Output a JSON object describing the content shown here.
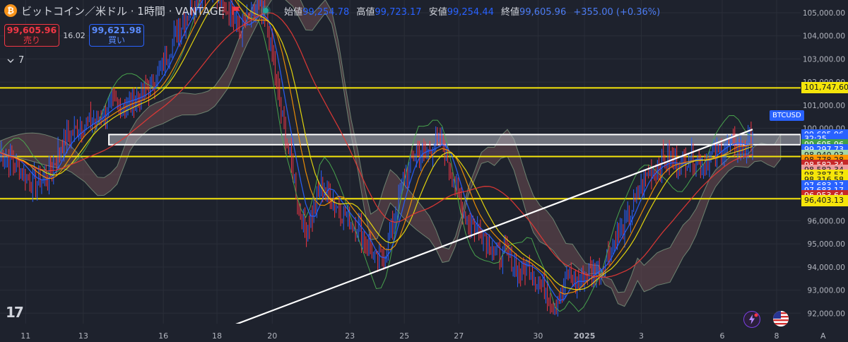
{
  "header": {
    "title": "ビットコイン／米ドル · 1時間 · VANTAGE",
    "coin_glyph": "₿",
    "open_label": "始値",
    "open": "99,254.78",
    "high_label": "高値",
    "high": "99,723.17",
    "low_label": "安値",
    "low": "99,254.44",
    "close_label": "終値",
    "close": "99,605.96",
    "change": "+355.00 (+0.36%)"
  },
  "trade": {
    "sell_price": "99,605.96",
    "sell_label": "売り",
    "spread": "16.02",
    "buy_price": "99,621.98",
    "buy_label": "買い"
  },
  "indicators": {
    "collapse_count": "7"
  },
  "logo": "17",
  "price_tags": [
    {
      "text": "101,747.60",
      "bg": "#f5e50a",
      "fg": "#131722",
      "price": 101747.6
    },
    {
      "text": "99,605.96",
      "bg": "#2962ff",
      "fg": "#ffffff",
      "price": 99700
    },
    {
      "text": "32:25",
      "bg": "#2962ff",
      "fg": "#ffffff",
      "price": 99520
    },
    {
      "text": "99,605.96",
      "bg": "#43a047",
      "fg": "#ffffff",
      "price": 99280
    },
    {
      "text": "99,297.73",
      "bg": "#2962ff",
      "fg": "#ffffff",
      "price": 99060
    },
    {
      "text": "98,940.03",
      "bg": "#a5d6a7",
      "fg": "#131722",
      "price": 98840
    },
    {
      "text": "98,778.28",
      "bg": "#ff9800",
      "fg": "#131722",
      "price": 98620
    },
    {
      "text": "98,582.34",
      "bg": "#c62828",
      "fg": "#ffffff",
      "price": 98400
    },
    {
      "text": "98,582.34",
      "bg": "#ef9a9a",
      "fg": "#131722",
      "price": 98180
    },
    {
      "text": "98,387.57",
      "bg": "#f5e50a",
      "fg": "#131722",
      "price": 97960
    },
    {
      "text": "98,316.58",
      "bg": "#f5e50a",
      "fg": "#131722",
      "price": 97740
    },
    {
      "text": "97,683.17",
      "bg": "#2962ff",
      "fg": "#ffffff",
      "price": 97520
    },
    {
      "text": "97,683.17",
      "bg": "#2962ff",
      "fg": "#ffffff",
      "price": 97300
    },
    {
      "text": "96,953.64",
      "bg": "#c62828",
      "fg": "#ffffff",
      "price": 97080
    },
    {
      "text": "96,403.13",
      "bg": "#f5e50a",
      "fg": "#131722",
      "price": 96860
    }
  ],
  "symbol_tag": "BTCUSD",
  "colors": {
    "background": "#1e222d",
    "grid": "#2a2e39",
    "hline": "#f5e50a",
    "trend": "#ffffff",
    "up": "#2962ff",
    "down": "#f23645",
    "green_line": "#4caf50",
    "red_line": "#e53935",
    "yellow_line": "#f5e50a",
    "blue_line": "#2962ff",
    "cloud": "#6d4c52"
  },
  "chart_data": {
    "type": "candlestick",
    "symbol": "BTCUSD",
    "interval": "1時間",
    "ylim": [
      91550,
      105550
    ],
    "y_ticks": [
      92000,
      93000,
      94000,
      95000,
      96000,
      97000,
      98000,
      99000,
      100000,
      101000,
      102000,
      103000,
      104000,
      105000
    ],
    "y_tick_labels": [
      "92,000.00",
      "93,000.00",
      "94,000.00",
      "95,000.00",
      "96,000.00",
      "97,000.00",
      "98,000.00",
      "99,000.00",
      "100,000.00",
      "101,000.00",
      "102,000.00",
      "103,000.00",
      "104,000.00",
      "105,000.00"
    ],
    "x_ticks": [
      {
        "label": "11",
        "pos": 0.032
      },
      {
        "label": "13",
        "pos": 0.104
      },
      {
        "label": "16",
        "pos": 0.204
      },
      {
        "label": "18",
        "pos": 0.271
      },
      {
        "label": "20",
        "pos": 0.34
      },
      {
        "label": "23",
        "pos": 0.437
      },
      {
        "label": "25",
        "pos": 0.505
      },
      {
        "label": "27",
        "pos": 0.573
      },
      {
        "label": "30",
        "pos": 0.672
      },
      {
        "label": "2025",
        "pos": 0.73,
        "bold": true
      },
      {
        "label": "3",
        "pos": 0.801
      },
      {
        "label": "6",
        "pos": 0.902
      },
      {
        "label": "8",
        "pos": 0.97
      },
      {
        "label": "A",
        "pos": 1.028
      }
    ],
    "horizontal_lines": [
      101747.6,
      98778.28,
      96953.64
    ],
    "zone": {
      "from": 99290,
      "to": 99730,
      "x_start": 0.136,
      "x_end": 1.0
    },
    "trendline": {
      "x1": 0.27,
      "y1": 91200,
      "x2": 0.94,
      "y2": 99950
    },
    "price_path": [
      [
        0.0,
        98950
      ],
      [
        0.02,
        98450
      ],
      [
        0.04,
        97600
      ],
      [
        0.06,
        97900
      ],
      [
        0.08,
        99500
      ],
      [
        0.1,
        100100
      ],
      [
        0.12,
        100400
      ],
      [
        0.14,
        100900
      ],
      [
        0.16,
        101100
      ],
      [
        0.18,
        101500
      ],
      [
        0.2,
        102500
      ],
      [
        0.22,
        104100
      ],
      [
        0.24,
        105300
      ],
      [
        0.26,
        106200
      ],
      [
        0.28,
        105500
      ],
      [
        0.3,
        104200
      ],
      [
        0.31,
        104600
      ],
      [
        0.32,
        105300
      ],
      [
        0.33,
        104800
      ],
      [
        0.34,
        103200
      ],
      [
        0.35,
        100800
      ],
      [
        0.36,
        99200
      ],
      [
        0.37,
        97200
      ],
      [
        0.38,
        95600
      ],
      [
        0.39,
        96200
      ],
      [
        0.4,
        97600
      ],
      [
        0.41,
        97200
      ],
      [
        0.42,
        96700
      ],
      [
        0.43,
        96300
      ],
      [
        0.44,
        95900
      ],
      [
        0.45,
        95600
      ],
      [
        0.46,
        95000
      ],
      [
        0.47,
        94200
      ],
      [
        0.48,
        94600
      ],
      [
        0.49,
        95800
      ],
      [
        0.5,
        97300
      ],
      [
        0.51,
        98200
      ],
      [
        0.52,
        99100
      ],
      [
        0.53,
        98700
      ],
      [
        0.54,
        99200
      ],
      [
        0.55,
        99400
      ],
      [
        0.56,
        98600
      ],
      [
        0.57,
        97300
      ],
      [
        0.58,
        96300
      ],
      [
        0.59,
        95800
      ],
      [
        0.6,
        95600
      ],
      [
        0.61,
        95200
      ],
      [
        0.62,
        94500
      ],
      [
        0.63,
        94600
      ],
      [
        0.64,
        94200
      ],
      [
        0.65,
        93800
      ],
      [
        0.66,
        94100
      ],
      [
        0.67,
        93400
      ],
      [
        0.68,
        93200
      ],
      [
        0.69,
        92300
      ],
      [
        0.7,
        92700
      ],
      [
        0.71,
        93800
      ],
      [
        0.72,
        93300
      ],
      [
        0.73,
        93600
      ],
      [
        0.74,
        93900
      ],
      [
        0.75,
        93900
      ],
      [
        0.76,
        94600
      ],
      [
        0.77,
        95300
      ],
      [
        0.78,
        95700
      ],
      [
        0.79,
        96600
      ],
      [
        0.8,
        97500
      ],
      [
        0.81,
        98100
      ],
      [
        0.82,
        98400
      ],
      [
        0.83,
        98700
      ],
      [
        0.84,
        98600
      ],
      [
        0.85,
        98500
      ],
      [
        0.86,
        98800
      ],
      [
        0.87,
        98700
      ],
      [
        0.88,
        98400
      ],
      [
        0.89,
        98900
      ],
      [
        0.9,
        99000
      ],
      [
        0.91,
        99300
      ],
      [
        0.92,
        99300
      ],
      [
        0.93,
        99100
      ],
      [
        0.94,
        99600
      ]
    ],
    "candles_per_step": 5
  }
}
